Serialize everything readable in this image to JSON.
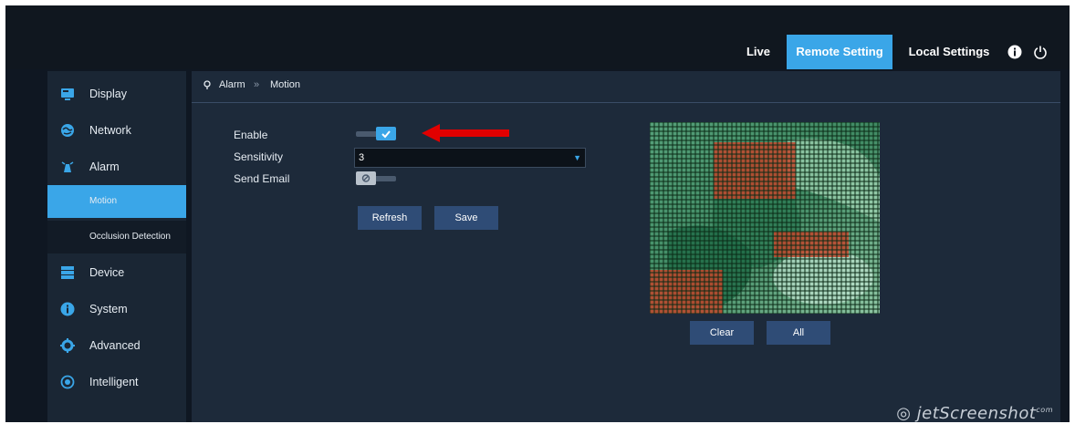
{
  "topnav": {
    "items": [
      {
        "label": "Live",
        "active": false
      },
      {
        "label": "Remote Setting",
        "active": true
      },
      {
        "label": "Local Settings",
        "active": false
      }
    ],
    "icons": [
      "info-icon",
      "power-icon"
    ]
  },
  "sidebar": {
    "items": [
      {
        "label": "Display",
        "icon": "display-icon"
      },
      {
        "label": "Network",
        "icon": "network-icon"
      },
      {
        "label": "Alarm",
        "icon": "alarm-icon"
      },
      {
        "label": "Device",
        "icon": "device-icon"
      },
      {
        "label": "System",
        "icon": "system-icon"
      },
      {
        "label": "Advanced",
        "icon": "advanced-icon"
      },
      {
        "label": "Intelligent",
        "icon": "intelligent-icon"
      }
    ],
    "alarm_sub": [
      {
        "label": "Motion",
        "active": true
      },
      {
        "label": "Occlusion Detection",
        "active": false
      }
    ]
  },
  "breadcrumb": {
    "root": "Alarm",
    "separator": "»",
    "current": "Motion"
  },
  "form": {
    "enable_label": "Enable",
    "enable_value": true,
    "sensitivity_label": "Sensitivity",
    "sensitivity_value": "3",
    "send_email_label": "Send Email",
    "send_email_value": false,
    "refresh_label": "Refresh",
    "save_label": "Save"
  },
  "motion_area": {
    "clear_label": "Clear",
    "all_label": "All"
  },
  "watermark": {
    "text": "jetScreenshot",
    "suffix": "com"
  },
  "colors": {
    "accent": "#3aa6e8",
    "grid_selected": "#2c8a47",
    "grid_active": "#c3452c",
    "arrow": "#e10000"
  }
}
